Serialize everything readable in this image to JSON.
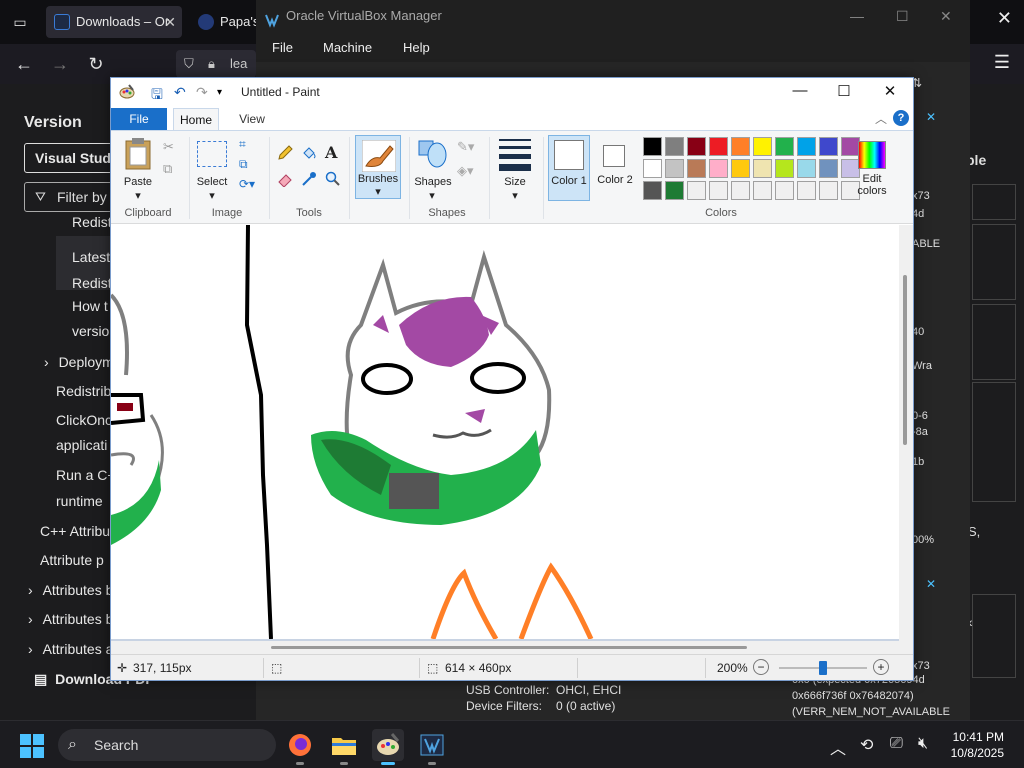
{
  "browser": {
    "tabs": [
      {
        "label": "Downloads – Or",
        "active": true
      },
      {
        "label": "Papa's",
        "active": false
      }
    ],
    "url_fragment": "lea",
    "sidebar": {
      "version_label": "Version",
      "version_select": "Visual Studi",
      "filter_placeholder": "Filter by",
      "items": [
        "Redist",
        "Latest",
        "Redist",
        "How t",
        "versio",
        "Deploym",
        "Redistrib",
        "ClickOnc",
        "applicati",
        "Run a C+",
        "runtime",
        "C++ Attribu",
        "Attribute p",
        "Attributes b",
        "Attributes b",
        "Attributes a",
        "Download PDF"
      ]
    },
    "right_fragments": [
      "ble",
      "x73",
      "4d",
      "ABLE",
      "40",
      "Wra",
      "0-6",
      "-8a",
      "1b",
      "S,",
      "00%",
      "x73"
    ]
  },
  "vbox": {
    "title": "Oracle VirtualBox Manager",
    "menu": [
      "File",
      "Machine",
      "Help"
    ],
    "details": [
      {
        "label": "USB Controller:",
        "value": "OHCI, EHCI"
      },
      {
        "label": "Device Filters:",
        "value": "0 (0 active)"
      }
    ],
    "log_lines": [
      "0x0 (expected 0x7265694d",
      "0x666f736f 0x76482074)",
      "(VERR_NEM_NOT_AVAILABLE"
    ]
  },
  "paint": {
    "title": "Untitled - Paint",
    "tabs": {
      "file": "File",
      "home": "Home",
      "view": "View"
    },
    "groups": {
      "clipboard": "Clipboard",
      "image": "Image",
      "tools": "Tools",
      "shapes": "Shapes",
      "colors": "Colors"
    },
    "buttons": {
      "paste": "Paste",
      "select": "Select",
      "brushes": "Brushes",
      "shapes": "Shapes",
      "size": "Size",
      "color1": "Color 1",
      "color2": "Color 2",
      "edit_colors": "Edit colors"
    },
    "palette_row1": [
      "#000000",
      "#7f7f7f",
      "#880015",
      "#ed1c24",
      "#ff7f27",
      "#fff200",
      "#22b14c",
      "#00a2e8",
      "#3f48cc",
      "#a349a4"
    ],
    "palette_row2": [
      "#ffffff",
      "#c3c3c3",
      "#b97a57",
      "#ffaec9",
      "#ffc90e",
      "#efe4b0",
      "#b5e61d",
      "#99d9ea",
      "#7092be",
      "#c8bfe7"
    ],
    "palette_row3": [
      "#555555",
      "#1e7b34",
      "#f0f0f0",
      "#f0f0f0",
      "#f0f0f0",
      "#f0f0f0",
      "#f0f0f0",
      "#f0f0f0",
      "#f0f0f0",
      "#f0f0f0"
    ],
    "status": {
      "cursor_pos": "317, 115px",
      "canvas_size": "614 × 460px",
      "zoom": "200%"
    },
    "zoom_level_fraction": 0.5
  },
  "taskbar": {
    "search_label": "Search",
    "time": "10:41 PM",
    "date": "10/8/2025"
  }
}
